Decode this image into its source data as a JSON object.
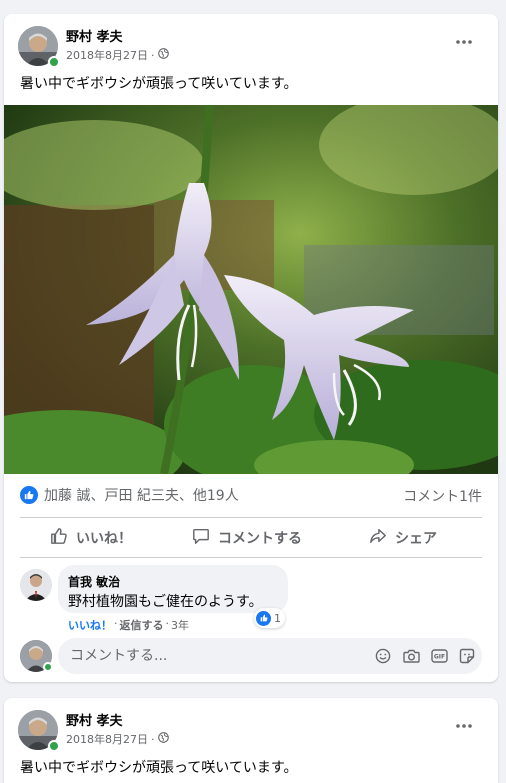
{
  "posts": [
    {
      "author": "野村 孝夫",
      "date": "2018年8月27日",
      "date_suffix": "·",
      "privacy_icon": "globe-icon",
      "text": "暑い中でギボウシが頑張って咲いています。",
      "photo_subject": "hosta-flower",
      "reactions_text": "加藤 誠、戸田 紀三夫、他19人",
      "comments_count": "コメント1件",
      "actions": {
        "like": "いいね！",
        "comment": "コメントする",
        "share": "シェア"
      },
      "comment": {
        "author": "首我 敏治",
        "text": "野村植物園もご健在のようす。",
        "reaction_count": "1",
        "like": "いいね！",
        "sep1": "·",
        "reply": "返信する",
        "sep2": "·",
        "age": "3年"
      },
      "comment_input": {
        "placeholder": "コメントする..."
      }
    },
    {
      "author": "野村 孝夫",
      "date": "2018年8月27日",
      "date_suffix": "·",
      "privacy_icon": "globe-icon",
      "text": "暑い中でギボウシが頑張って咲いています。"
    }
  ],
  "colors": {
    "brand": "#1877f2",
    "online": "#31a24c",
    "background": "#f0f2f5",
    "secondary_text": "#65676b"
  },
  "icons": [
    "more-options-icon",
    "globe-icon",
    "like-badge-icon",
    "thumbs-up-icon",
    "comment-icon",
    "share-icon",
    "emoji-icon",
    "camera-icon",
    "gif-icon",
    "sticker-icon"
  ]
}
